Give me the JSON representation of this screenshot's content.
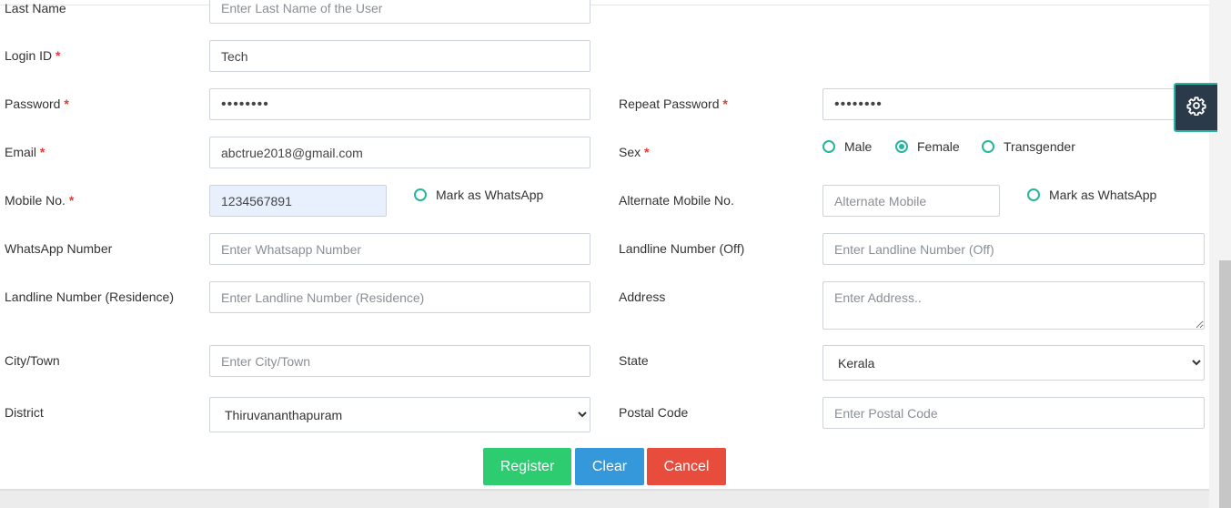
{
  "form": {
    "last_name": {
      "label": "Last Name",
      "placeholder": "Enter Last Name of the User",
      "value": ""
    },
    "login_id": {
      "label": "Login ID",
      "value": "Tech"
    },
    "password": {
      "label": "Password",
      "value": "••••••••"
    },
    "repeat_password": {
      "label": "Repeat Password",
      "value": "••••••••"
    },
    "email": {
      "label": "Email",
      "value": "abctrue2018@gmail.com"
    },
    "sex": {
      "label": "Sex",
      "options": [
        "Male",
        "Female",
        "Transgender"
      ],
      "selected": "Female"
    },
    "mobile": {
      "label": "Mobile No.",
      "value": "1234567891",
      "whatsapp_label": "Mark as WhatsApp"
    },
    "alt_mobile": {
      "label": "Alternate Mobile No.",
      "placeholder": "Alternate Mobile",
      "whatsapp_label": "Mark as WhatsApp"
    },
    "whatsapp": {
      "label": "WhatsApp Number",
      "placeholder": "Enter Whatsapp Number"
    },
    "landline_off": {
      "label": "Landline Number (Off)",
      "placeholder": "Enter Landline Number (Off)"
    },
    "landline_res": {
      "label": "Landline Number (Residence)",
      "placeholder": "Enter Landline Number (Residence)"
    },
    "address": {
      "label": "Address",
      "placeholder": "Enter Address.."
    },
    "city": {
      "label": "City/Town",
      "placeholder": "Enter City/Town"
    },
    "state": {
      "label": "State",
      "value": "Kerala"
    },
    "district": {
      "label": "District",
      "value": "Thiruvananthapuram"
    },
    "postal": {
      "label": "Postal Code",
      "placeholder": "Enter Postal Code"
    },
    "required_mark": "*"
  },
  "buttons": {
    "register": "Register",
    "clear": "Clear",
    "cancel": "Cancel"
  },
  "colors": {
    "accent": "#26b5a0",
    "register": "#2ecc71",
    "clear": "#3498db",
    "cancel": "#e74c3c",
    "required": "#e53935"
  },
  "icons": {
    "settings": "gear-icon"
  }
}
